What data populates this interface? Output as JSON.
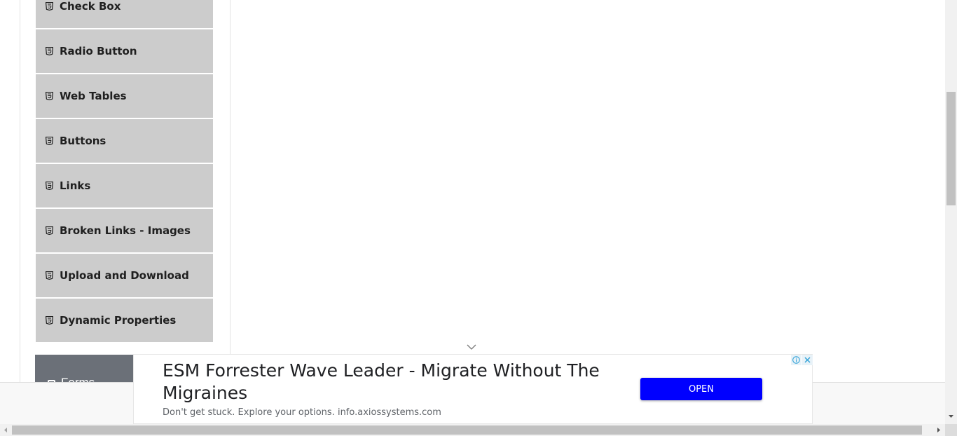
{
  "sidebar": {
    "items": [
      {
        "label": "Check Box",
        "icon": "html5-icon"
      },
      {
        "label": "Radio Button",
        "icon": "html5-icon"
      },
      {
        "label": "Web Tables",
        "icon": "html5-icon"
      },
      {
        "label": "Buttons",
        "icon": "html5-icon"
      },
      {
        "label": "Links",
        "icon": "html5-icon"
      },
      {
        "label": "Broken Links - Images",
        "icon": "html5-icon"
      },
      {
        "label": "Upload and Download",
        "icon": "html5-icon"
      },
      {
        "label": "Dynamic Properties",
        "icon": "html5-icon"
      }
    ],
    "next_group": {
      "label": "Forms",
      "icon": "form-icon"
    }
  },
  "ad": {
    "title": "ESM Forrester Wave Leader - Migrate Without The Migraines",
    "subtitle": "Don't get stuck. Explore your options. info.axiossystems.com",
    "open_label": "OPEN",
    "button_color": "#0000ff"
  },
  "colors": {
    "menu_item_bg": "#cccccc",
    "group_header_bg": "#6b7078"
  }
}
